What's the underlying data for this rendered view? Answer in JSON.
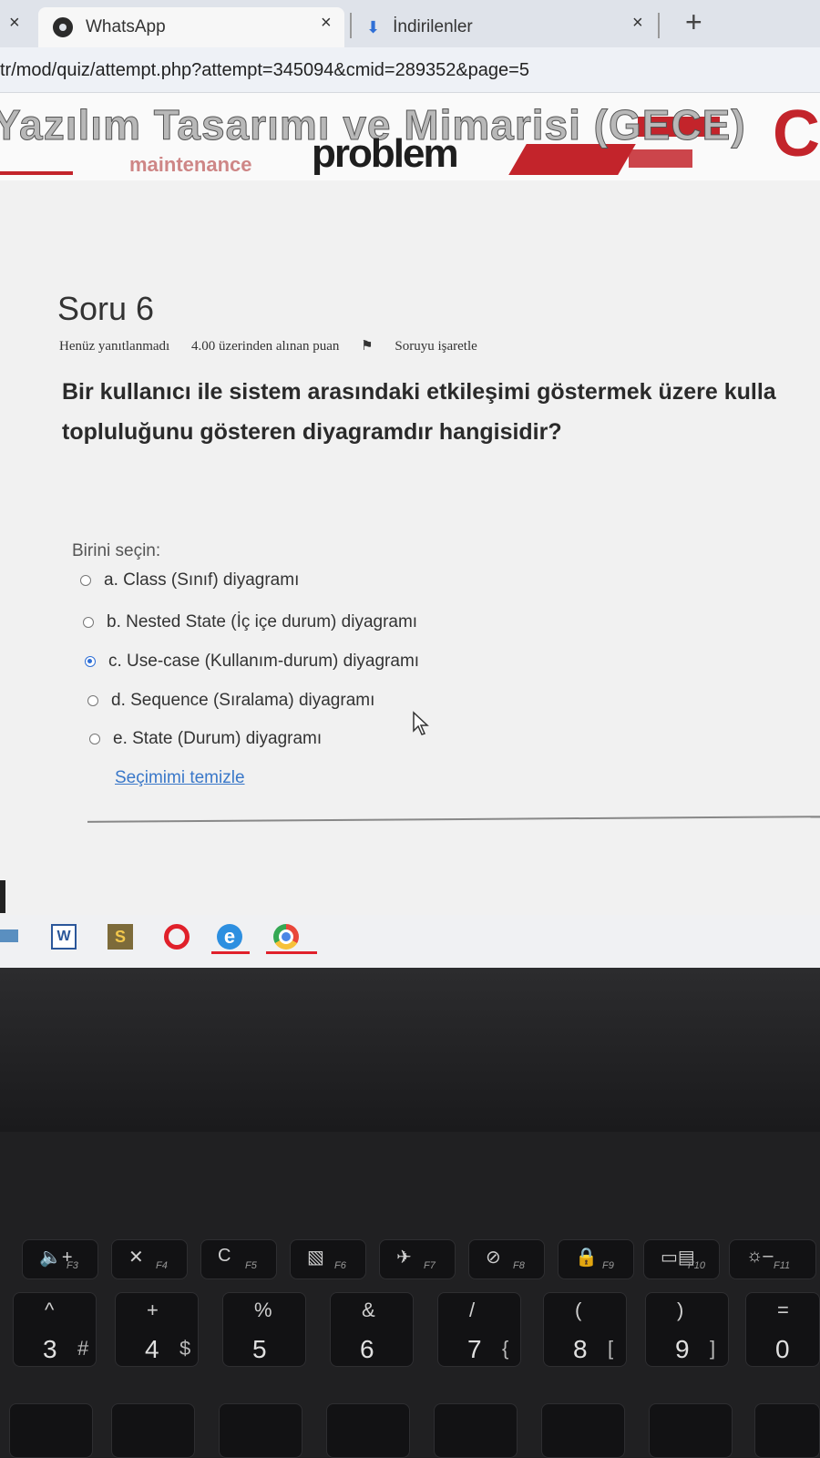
{
  "browser": {
    "tabs": [
      {
        "label": "WhatsApp",
        "icon": "whatsapp-icon"
      },
      {
        "label": "İndirilenler",
        "icon": "download-icon"
      }
    ],
    "close_glyph": "×",
    "new_tab_glyph": "+",
    "url": "tr/mod/quiz/attempt.php?attempt=345094&cmid=289352&page=5"
  },
  "banner": {
    "course_title": "Yazılım Tasarımı ve Mimarisi (GECE)",
    "overlay_word": "problem",
    "overlay_sub": "maintenance",
    "letter": "C"
  },
  "question": {
    "title": "Soru 6",
    "status": "Henüz yanıtlanmadı",
    "points": "4.00 üzerinden alınan puan",
    "flag_label": "Soruyu işaretle",
    "text_line1": "Bir kullanıcı ile sistem arasındaki etkileşimi göstermek üzere kulla",
    "text_line2": "topluluğunu gösteren diyagramdır hangisidir?",
    "prompt": "Birini seçin:",
    "answers": [
      {
        "label": "a. Class (Sınıf) diyagramı",
        "selected": false
      },
      {
        "label": "b. Nested State (İç içe durum) diyagramı",
        "selected": false
      },
      {
        "label": "c. Use-case (Kullanım-durum) diyagramı",
        "selected": true
      },
      {
        "label": "d. Sequence (Sıralama) diyagramı",
        "selected": false
      },
      {
        "label": "e. State (Durum) diyagramı",
        "selected": false
      }
    ],
    "clear_label": "Seçimimi temizle"
  },
  "taskbar": {
    "apps": [
      "word-icon",
      "sublime-icon",
      "opera-icon",
      "edge-icon",
      "chrome-icon"
    ],
    "word_letter": "W",
    "sublime_letter": "S",
    "edge_letter": "e"
  },
  "keyboard": {
    "function_keys": [
      {
        "symbol": "🔈+",
        "label": "F3"
      },
      {
        "symbol": "✕",
        "label": "F4"
      },
      {
        "symbol": "C",
        "label": "F5"
      },
      {
        "symbol": "▧",
        "label": "F6"
      },
      {
        "symbol": "✈",
        "label": "F7"
      },
      {
        "symbol": "⊘",
        "label": "F8"
      },
      {
        "symbol": "🔒",
        "label": "F9"
      },
      {
        "symbol": "▭▤",
        "label": "F10"
      },
      {
        "symbol": "☼–",
        "label": "F11"
      }
    ],
    "number_keys": [
      {
        "top": "^",
        "main": "3",
        "alt": "#"
      },
      {
        "top": "+",
        "main": "4",
        "alt": "$"
      },
      {
        "top": "%",
        "main": "5",
        "alt": ""
      },
      {
        "top": "&",
        "main": "6",
        "alt": ""
      },
      {
        "top": "/",
        "main": "7",
        "alt": "{"
      },
      {
        "top": "(",
        "main": "8",
        "alt": "["
      },
      {
        "top": ")",
        "main": "9",
        "alt": "]"
      },
      {
        "top": "=",
        "main": "0",
        "alt": ""
      }
    ]
  }
}
